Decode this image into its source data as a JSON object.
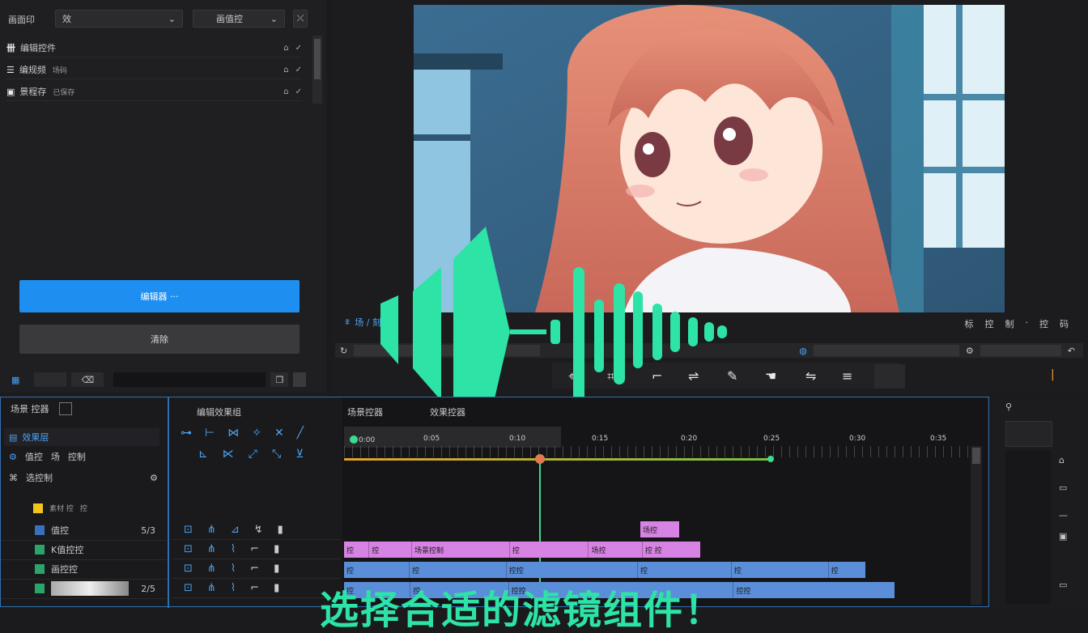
{
  "left_panel": {
    "top_label": "画面印",
    "dropdown1": "效",
    "dropdown2": "画值控",
    "items": [
      {
        "label": "编辑控件",
        "icon": "bars-icon"
      },
      {
        "label": "编规频",
        "sub": "场码",
        "icon": "layout-icon"
      },
      {
        "label": "景程存",
        "sub": "已保存",
        "icon": "image-icon"
      }
    ],
    "primary_button": "编辑器 ···",
    "secondary_button": "清除"
  },
  "preview": {
    "label": "场 / 刻控",
    "right_labels": [
      "标",
      "控",
      "制",
      "·",
      "控",
      "码"
    ]
  },
  "timeline": {
    "panel_tab": "场景 控器",
    "track_header_rows": [
      {
        "label": "效果层"
      },
      {
        "label": "值控",
        "extra": "场",
        "extra2": "控制"
      },
      {
        "label": "选控制"
      }
    ],
    "effect_header": "编辑效果组",
    "section_labels": [
      "场景控器",
      "效果控器"
    ],
    "ruler_labels": [
      "0:00",
      "0:05",
      "0:10",
      "0:15",
      "0:20",
      "0:25",
      "0:30",
      "0:35"
    ],
    "tracks": [
      {
        "name": "素材 控",
        "tag": "控"
      },
      {
        "name": "值控",
        "tag": "5/3"
      },
      {
        "name": "K值控控",
        "tag": ""
      },
      {
        "name": "画控控",
        "tag": ""
      },
      {
        "name": "",
        "tag": "2/5"
      }
    ],
    "pink_clips": [
      "控",
      "控",
      "场景控制",
      "控",
      "场控",
      "控 控",
      "场控"
    ],
    "blue_clips": [
      "控",
      "控",
      "控控",
      "控",
      "控",
      "控"
    ],
    "blue_clips2": [
      "控",
      "控",
      "控控",
      "控控"
    ]
  },
  "subtitle": "选择合适的滤镜组件！",
  "colors": {
    "accent": "#1e8ff0",
    "waveform": "#2de3a6",
    "pink_clip": "#d783e3",
    "blue_clip": "#5b8ed8",
    "playhead": "#3cdc8c"
  }
}
